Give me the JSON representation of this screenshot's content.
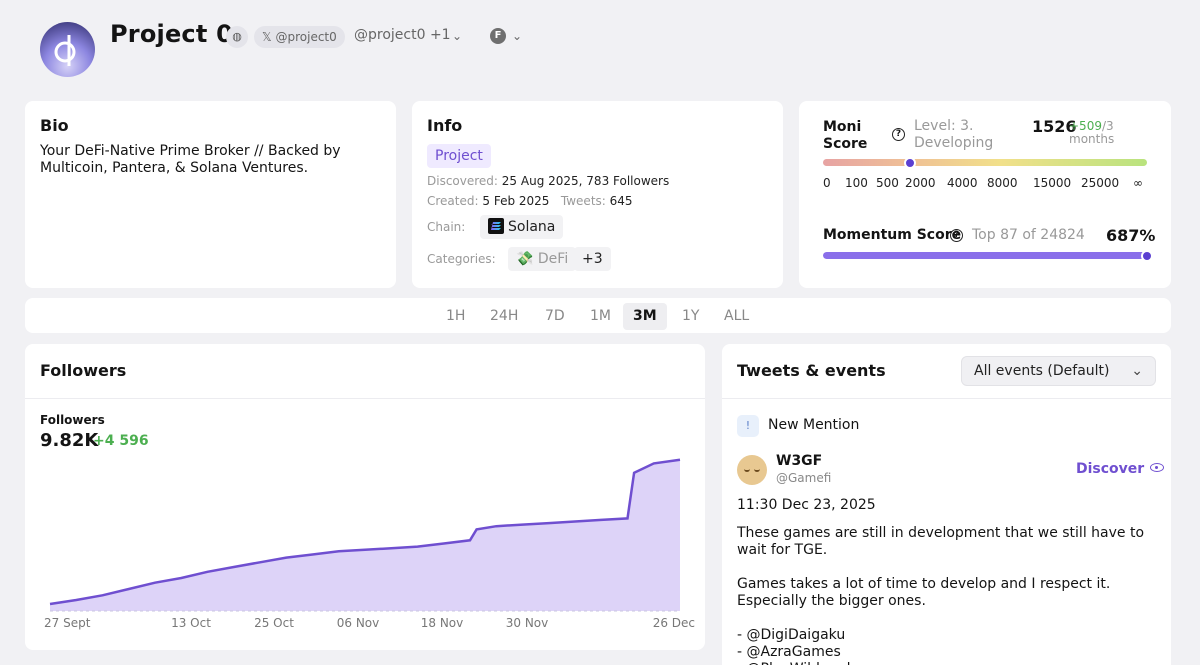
{
  "header": {
    "title": "Project 0",
    "x_handle": "𝕏 @project0",
    "handle": "@project0",
    "handle_extra": "+1"
  },
  "bio": {
    "heading": "Bio",
    "text": "Your DeFi-Native Prime Broker // Backed by Multicoin, Pantera, & Solana Ventures."
  },
  "info": {
    "heading": "Info",
    "type_badge": "Project",
    "discovered_label": "Discovered:",
    "discovered_value": "25 Aug 2025, 783 Followers",
    "created_label": "Created:",
    "created_value": "5 Feb 2025",
    "tweets_label": "Tweets:",
    "tweets_value": "645",
    "chain_label": "Chain:",
    "chain_value": "Solana",
    "categories_label": "Categories:",
    "category": "DeFi",
    "category_more": "+3"
  },
  "moni": {
    "label": "Moni Score",
    "level": "Level: 3. Developing",
    "value": "1526",
    "delta": "+509",
    "delta_period": "/3",
    "months": "months",
    "scale_ticks": [
      "0",
      "100",
      "500",
      "2000",
      "4000",
      "8000",
      "15000",
      "25000",
      "∞"
    ],
    "momentum_label": "Momentum Score",
    "momentum_rank": "Top 87 of 24824",
    "momentum_value": "687%",
    "momentum_fill": 1.0
  },
  "ranges": {
    "items": [
      "1H",
      "24H",
      "7D",
      "1M",
      "3M",
      "1Y",
      "ALL"
    ],
    "active": "3M"
  },
  "followers": {
    "heading": "Followers",
    "sub_label": "Followers",
    "value": "9.82K",
    "delta": "+4 596"
  },
  "chart_data": {
    "type": "area",
    "title": "Followers",
    "x_ticks": [
      "27 Sept",
      "13 Oct",
      "25 Oct",
      "06 Nov",
      "18 Nov",
      "30 Nov",
      "26 Dec"
    ],
    "x": [
      0,
      4,
      8,
      12,
      16,
      20,
      24,
      28,
      32,
      36,
      40,
      44,
      48,
      52,
      56,
      60,
      64,
      65,
      68,
      72,
      76,
      80,
      84,
      88,
      89,
      92,
      96
    ],
    "y": [
      5224,
      5350,
      5500,
      5700,
      5900,
      6050,
      6250,
      6400,
      6550,
      6700,
      6800,
      6900,
      6950,
      7000,
      7050,
      7150,
      7250,
      7600,
      7700,
      7750,
      7800,
      7850,
      7900,
      7950,
      9400,
      9700,
      9820
    ],
    "ylim": [
      5000,
      10000
    ],
    "color": "#6f4fd0",
    "fill": "#ddd3f8"
  },
  "tweets": {
    "heading": "Tweets & events",
    "filter": "All events (Default)",
    "event_type": "New Mention",
    "author_name": "W3GF",
    "author_handle": "@Gamefi",
    "discover": "Discover",
    "time": "11:30 Dec 23, 2025",
    "body": "These games are still in development that we still have to wait for TGE.\n\nGames takes a lot of time to develop and I respect it. Especially the bigger ones.\n\n- @DigiDaigaku\n- @AzraGames\n- @PlayWildcard"
  }
}
